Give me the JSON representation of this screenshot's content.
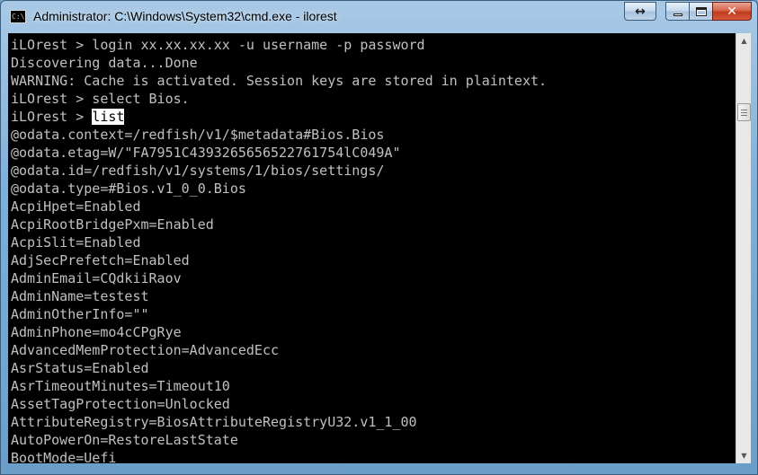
{
  "window": {
    "title": "Administrator: C:\\Windows\\System32\\cmd.exe - ilorest",
    "icon_label": "C:\\",
    "icon": "cmd-icon"
  },
  "caption_buttons": {
    "resize": "↔",
    "close": "✕"
  },
  "console": {
    "lines": [
      {
        "text": "iLOrest > login xx.xx.xx.xx -u username -p password"
      },
      {
        "text": "Discovering data...Done"
      },
      {
        "text": "WARNING: Cache is activated. Session keys are stored in plaintext."
      },
      {
        "text": "iLOrest > select Bios."
      },
      {
        "text": "iLOrest > ",
        "highlight": "list"
      },
      {
        "text": "@odata.context=/redfish/v1/$metadata#Bios.Bios"
      },
      {
        "text": "@odata.etag=W/\"FA7951C4393265656522761754lC049A\""
      },
      {
        "text": "@odata.id=/redfish/v1/systems/1/bios/settings/"
      },
      {
        "text": "@odata.type=#Bios.v1_0_0.Bios"
      },
      {
        "text": "AcpiHpet=Enabled"
      },
      {
        "text": "AcpiRootBridgePxm=Enabled"
      },
      {
        "text": "AcpiSlit=Enabled"
      },
      {
        "text": "AdjSecPrefetch=Enabled"
      },
      {
        "text": "AdminEmail=CQdkiiRaov"
      },
      {
        "text": "AdminName=testest"
      },
      {
        "text": "AdminOtherInfo=\"\""
      },
      {
        "text": "AdminPhone=mo4cCPgRye"
      },
      {
        "text": "AdvancedMemProtection=AdvancedEcc"
      },
      {
        "text": "AsrStatus=Enabled"
      },
      {
        "text": "AsrTimeoutMinutes=Timeout10"
      },
      {
        "text": "AssetTagProtection=Unlocked"
      },
      {
        "text": "AttributeRegistry=BiosAttributeRegistryU32.v1_1_00"
      },
      {
        "text": "AutoPowerOn=RestoreLastState"
      },
      {
        "text": "BootMode=Uefi"
      }
    ]
  },
  "colors": {
    "console_bg": "#000000",
    "console_fg": "#c0c0c0",
    "highlight_bg": "#ffffff"
  }
}
